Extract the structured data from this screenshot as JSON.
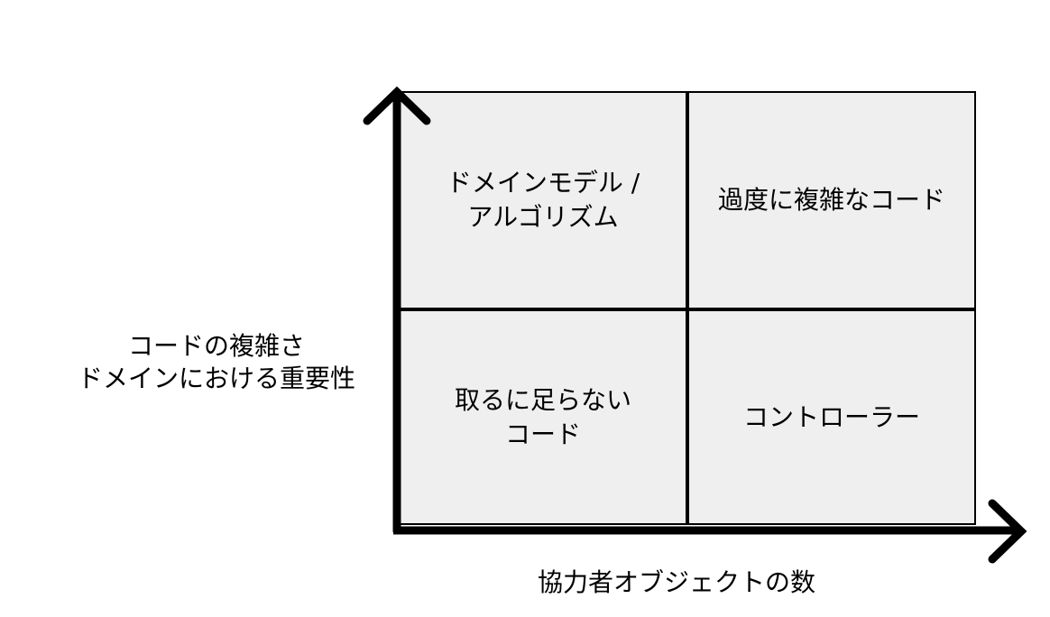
{
  "quadrants": {
    "top_left": [
      "ドメインモデル /",
      "アルゴリズム"
    ],
    "top_right": [
      "過度に複雑なコード"
    ],
    "bottom_left": [
      "取るに足らない",
      "コード"
    ],
    "bottom_right": [
      "コントローラー"
    ]
  },
  "y_axis_label": [
    "コードの複雑さ",
    "ドメインにおける重要性"
  ],
  "x_axis_label": "協力者オブジェクトの数",
  "colors": {
    "quadrant_fill": "#efefef",
    "lines": "#000000"
  }
}
